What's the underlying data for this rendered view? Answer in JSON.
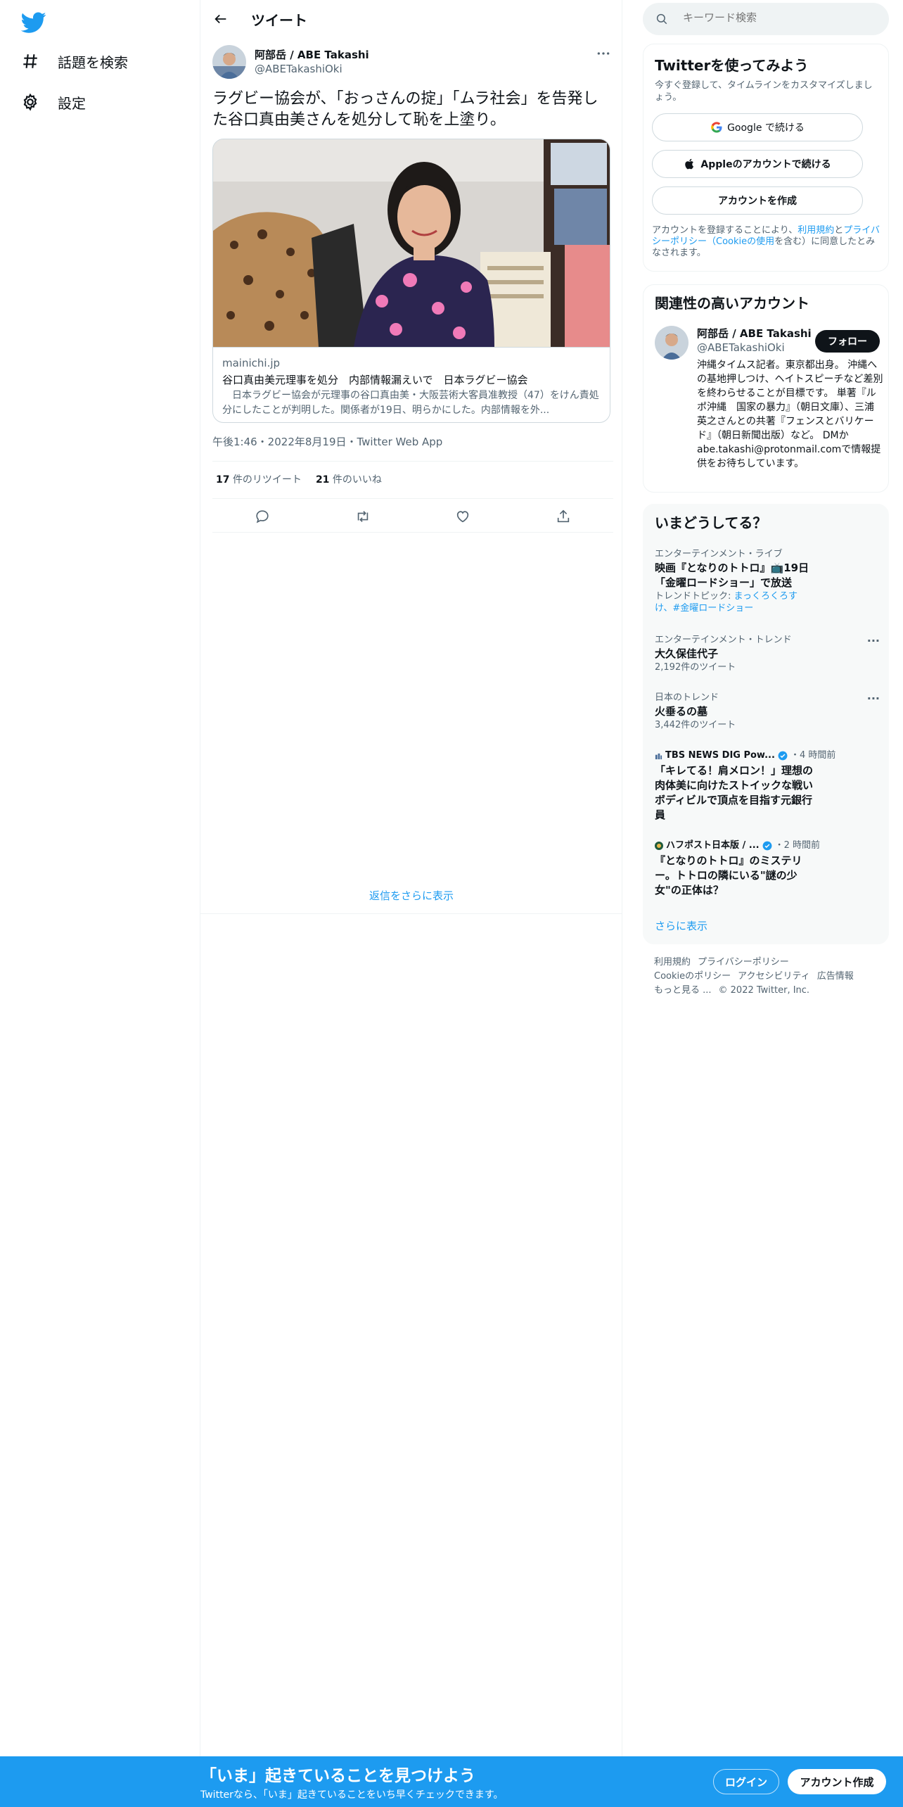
{
  "nav": {
    "explore_label": "話題を検索",
    "settings_label": "設定"
  },
  "header": {
    "title": "ツイート"
  },
  "tweet": {
    "author_name": "阿部岳 / ABE Takashi",
    "author_handle": "@ABETakashiOki",
    "text": "ラグビー協会が、「おっさんの掟」「ムラ社会」を告発した谷口真由美さんを処分して恥を上塗り。",
    "card": {
      "domain": "mainichi.jp",
      "title": "谷口真由美元理事を処分　内部情報漏えいで　日本ラグビー協会",
      "description": "　日本ラグビー協会が元理事の谷口真由美・大阪芸術大客員准教授（47）をけん責処分にしたことが判明した。関係者が19日、明らかにした。内部情報を外..."
    },
    "timestamp": "午後1:46・2022年8月19日・Twitter Web App",
    "retweets_count": "17",
    "retweets_label": "件のリツイート",
    "likes_count": "21",
    "likes_label": "件のいいね",
    "show_more_replies": "返信をさらに表示"
  },
  "search": {
    "placeholder": "キーワード検索"
  },
  "signup": {
    "title": "Twitterを使ってみよう",
    "subtitle": "今すぐ登録して、タイムラインをカスタマイズしましょう。",
    "google_label": "Google で続ける",
    "apple_label": "Appleのアカウントで続ける",
    "create_label": "アカウントを作成",
    "legal_prefix": "アカウントを登録することにより、",
    "legal_terms": "利用規約",
    "legal_and": "と",
    "legal_privacy": "プライバシーポリシー（Cookieの使用",
    "legal_suffix": "を含む）に同意したとみなされます。"
  },
  "related": {
    "title": "関連性の高いアカウント",
    "name": "阿部岳 / ABE Takashi",
    "handle": "@ABETakashiOki",
    "follow_label": "フォロー",
    "bio": "沖縄タイムス記者。東京都出身。 沖縄への基地押しつけ、ヘイトスピーチなど差別を終わらせることが目標です。 単著『ルポ沖縄　国家の暴力』（朝日文庫）、三浦英之さんとの共著『フェンスとバリケード』（朝日新聞出版）など。 DMか abe.takashi@protonmail.comで情報提供をお待ちしています。"
  },
  "trends": {
    "title": "いまどうしてる？",
    "items": [
      {
        "category": "エンターテインメント・ライブ",
        "name_line1": "映画『となりのトトロ』📺19日",
        "name_line2": "「金曜ロードショー」で放送",
        "meta_prefix": "トレンドトピック: ",
        "meta_link1": "まっくろくろすけ",
        "meta_sep": "、",
        "meta_link2": "#金曜ロードショー"
      },
      {
        "category": "エンターテインメント・トレンド",
        "name": "大久保佳代子",
        "meta": "2,192件のツイート"
      },
      {
        "category": "日本のトレンド",
        "name": "火垂るの墓",
        "meta": "3,442件のツイート"
      }
    ],
    "news": [
      {
        "source": "TBS NEWS DIG Pow...",
        "time": "・4 時間前",
        "title": "「キレてる！肩メロン！」理想の肉体美に向けたストイックな戦いボディビルで頂点を目指す元銀行員"
      },
      {
        "source": "ハフポスト日本版 / ...",
        "time": "・2 時間前",
        "title": "『となりのトトロ』のミステリー。トトロの隣にいる\"謎の少女\"の正体は？"
      }
    ],
    "more_label": "さらに表示",
    "more_dots": "···"
  },
  "footer": {
    "terms": "利用規約",
    "privacy": "プライバシーポリシー",
    "cookie": "Cookieのポリシー",
    "accessibility": "アクセシビリティ",
    "ads": "広告情報",
    "more": "もっと見る ...",
    "copyright": "© 2022 Twitter, Inc."
  },
  "bottombar": {
    "title": "「いま」起きていることを見つけよう",
    "subtitle": "Twitterなら、「いま」起きていることをいち早くチェックできます。",
    "login_label": "ログイン",
    "signup_label": "アカウント作成"
  },
  "colors": {
    "brand": "#1d9bf0",
    "text": "#0f1419",
    "secondary": "#536471"
  }
}
